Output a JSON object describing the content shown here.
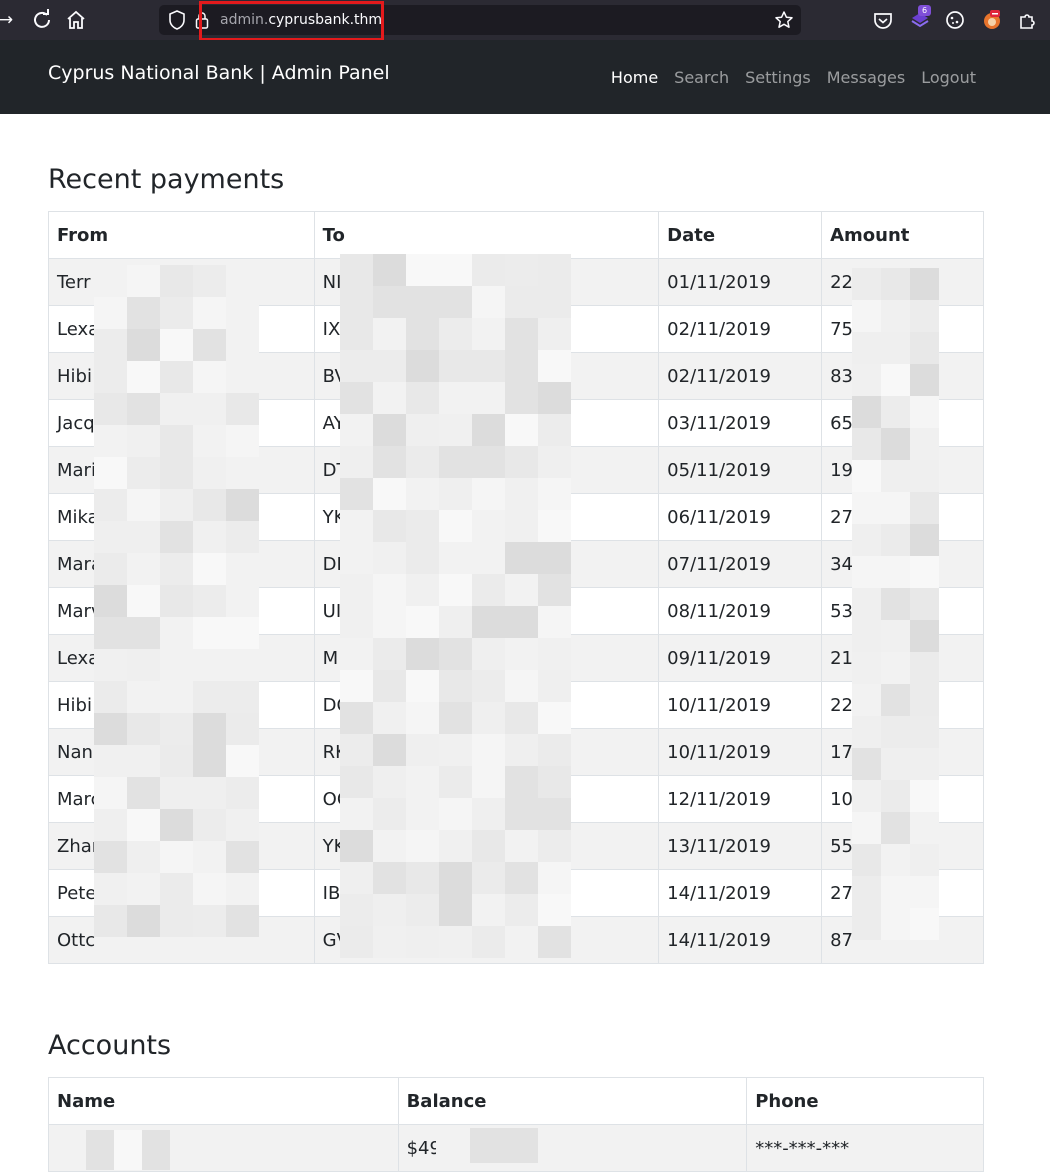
{
  "browser": {
    "url_subdomain": "admin.",
    "url_domain": "cyprusbank.thm",
    "extensions_badge": "6",
    "icons": [
      "arrow-right-icon",
      "reload-icon",
      "home-icon",
      "shield-icon",
      "lock-icon",
      "star-icon",
      "pocket-icon",
      "extension-icon",
      "cookie-icon",
      "fox-icon",
      "puzzle-icon"
    ]
  },
  "navbar": {
    "brand": "Cyprus National Bank | Admin Panel",
    "links": [
      "Home",
      "Search",
      "Settings",
      "Messages",
      "Logout"
    ],
    "active": "Home"
  },
  "payments": {
    "title": "Recent payments",
    "headers": [
      "From",
      "To",
      "Date",
      "Amount"
    ],
    "rows": [
      {
        "from": "Terr",
        "to": "NI",
        "date": "01/11/2019",
        "amount": "22"
      },
      {
        "from": "Lexa",
        "to": "IX",
        "date": "02/11/2019",
        "amount": "75"
      },
      {
        "from": "Hibi",
        "to": "BV",
        "date": "02/11/2019",
        "amount": "83"
      },
      {
        "from": "Jacq",
        "to": "AY",
        "date": "03/11/2019",
        "amount": "65"
      },
      {
        "from": "Mari",
        "to": "DT",
        "date": "05/11/2019",
        "amount": "19"
      },
      {
        "from": "Mika",
        "to": "YK",
        "date": "06/11/2019",
        "amount": "27"
      },
      {
        "from": "Mara",
        "to": "DI",
        "date": "07/11/2019",
        "amount": "34"
      },
      {
        "from": "Marv",
        "to": "UI",
        "date": "08/11/2019",
        "amount": "53"
      },
      {
        "from": "Lexa",
        "to": "M",
        "date": "09/11/2019",
        "amount": "21"
      },
      {
        "from": "Hibi",
        "to": "DC",
        "date": "10/11/2019",
        "amount": "22"
      },
      {
        "from": "Nan",
        "to": "RK",
        "date": "10/11/2019",
        "amount": "17"
      },
      {
        "from": "Marc",
        "to": "OC",
        "date": "12/11/2019",
        "amount": "10"
      },
      {
        "from": "Zhar",
        "to": "YK",
        "date": "13/11/2019",
        "amount": "55"
      },
      {
        "from": "Pete",
        "to": "IB",
        "date": "14/11/2019",
        "amount": "27"
      },
      {
        "from": "Ottc",
        "to": "GV",
        "date": "14/11/2019",
        "amount": "87"
      }
    ]
  },
  "accounts": {
    "title": "Accounts",
    "headers": [
      "Name",
      "Balance",
      "Phone"
    ],
    "rows": [
      {
        "name": "",
        "balance": "$49",
        "phone": "***-***-***"
      }
    ]
  },
  "colors": {
    "navbar_bg": "#212529",
    "browser_bg": "#2b2a33",
    "url_highlight": "#e31a1c",
    "stripe": "#f2f2f2"
  }
}
